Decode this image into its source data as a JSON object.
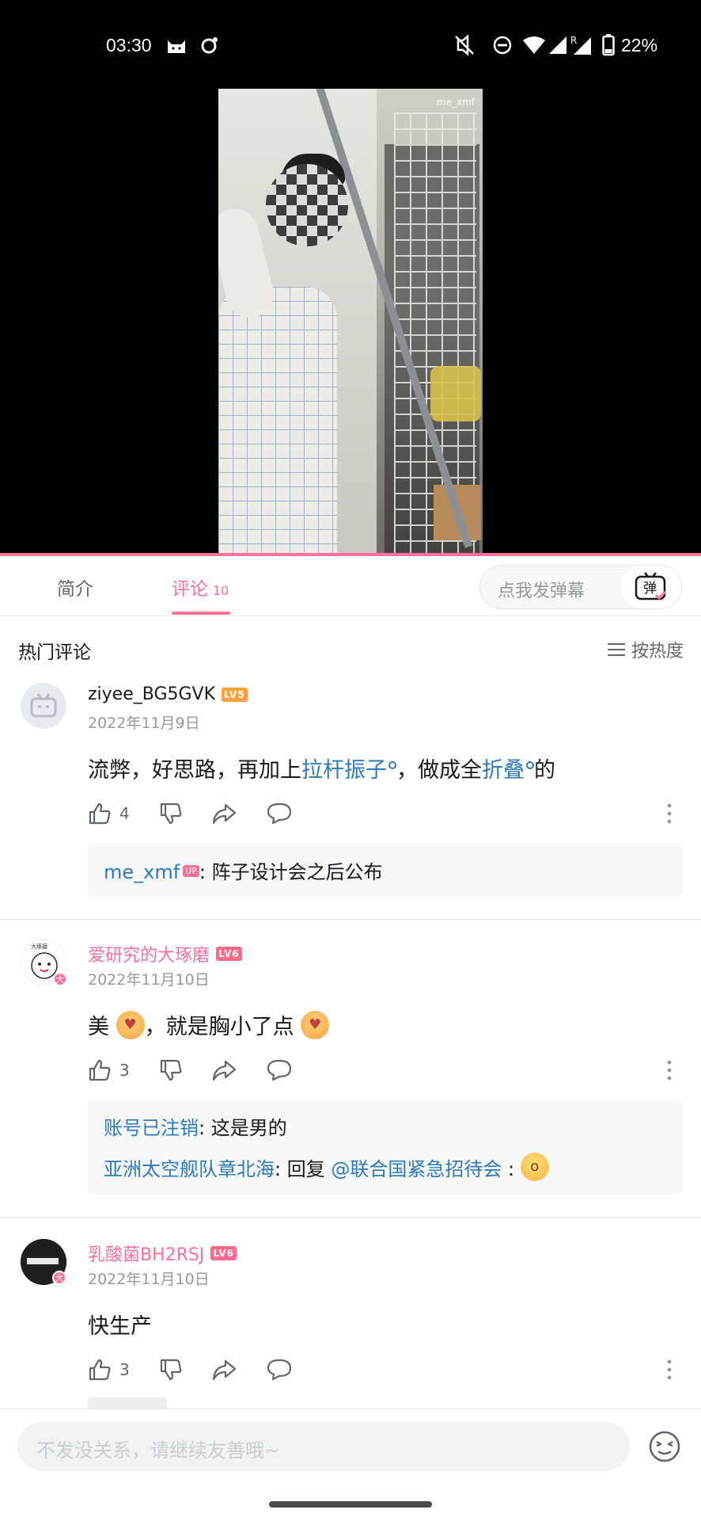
{
  "status_bar": {
    "time": "03:30",
    "battery_percent": "22%",
    "icons": [
      "cat-notification-icon",
      "bug-notification-icon",
      "vibrate-off-icon",
      "do-not-disturb-icon",
      "wifi-icon",
      "signal-icon",
      "roaming-signal-icon",
      "battery-icon"
    ]
  },
  "video": {
    "watermark": "me_xmf",
    "progress": 1.0,
    "accent_color": "#fb7299"
  },
  "tabs": {
    "intro_label": "简介",
    "comments_label": "评论",
    "comments_count": "10",
    "danmaku_placeholder": "点我发弹幕",
    "danmaku_button_label": "弹"
  },
  "comments_header": {
    "title": "热门评论",
    "sort_label": "按热度"
  },
  "comments": [
    {
      "username": "ziyee_BG5GVK",
      "level": "LV5",
      "date": "2022年11月9日",
      "text_parts": [
        "流弊，好思路，再加上",
        "拉杆振子",
        "，做成全",
        "折叠",
        "的"
      ],
      "likes": "4",
      "replies": [
        {
          "user": "me_xmf",
          "tag": "UP",
          "text": ": 阵子设计会之后公布"
        }
      ]
    },
    {
      "username": "爱研究的大琢磨",
      "level": "LV6",
      "date": "2022年11月10日",
      "text_parts": [
        "美",
        "，就是胸小了点"
      ],
      "likes": "3",
      "replies": [
        {
          "user": "账号已注销",
          "text": ": 这是男的"
        },
        {
          "user": "亚洲太空舰队章北海",
          "text": ": 回复 ",
          "mention": "@联合国紧急招待会",
          "suffix": " :"
        }
      ]
    },
    {
      "username": "乳酸菌BH2RSJ",
      "level": "LV6",
      "date": "2022年11月10日",
      "text": "快生产",
      "likes": "3"
    }
  ],
  "bottom": {
    "input_placeholder": "不发没关系，请继续友善哦~"
  }
}
